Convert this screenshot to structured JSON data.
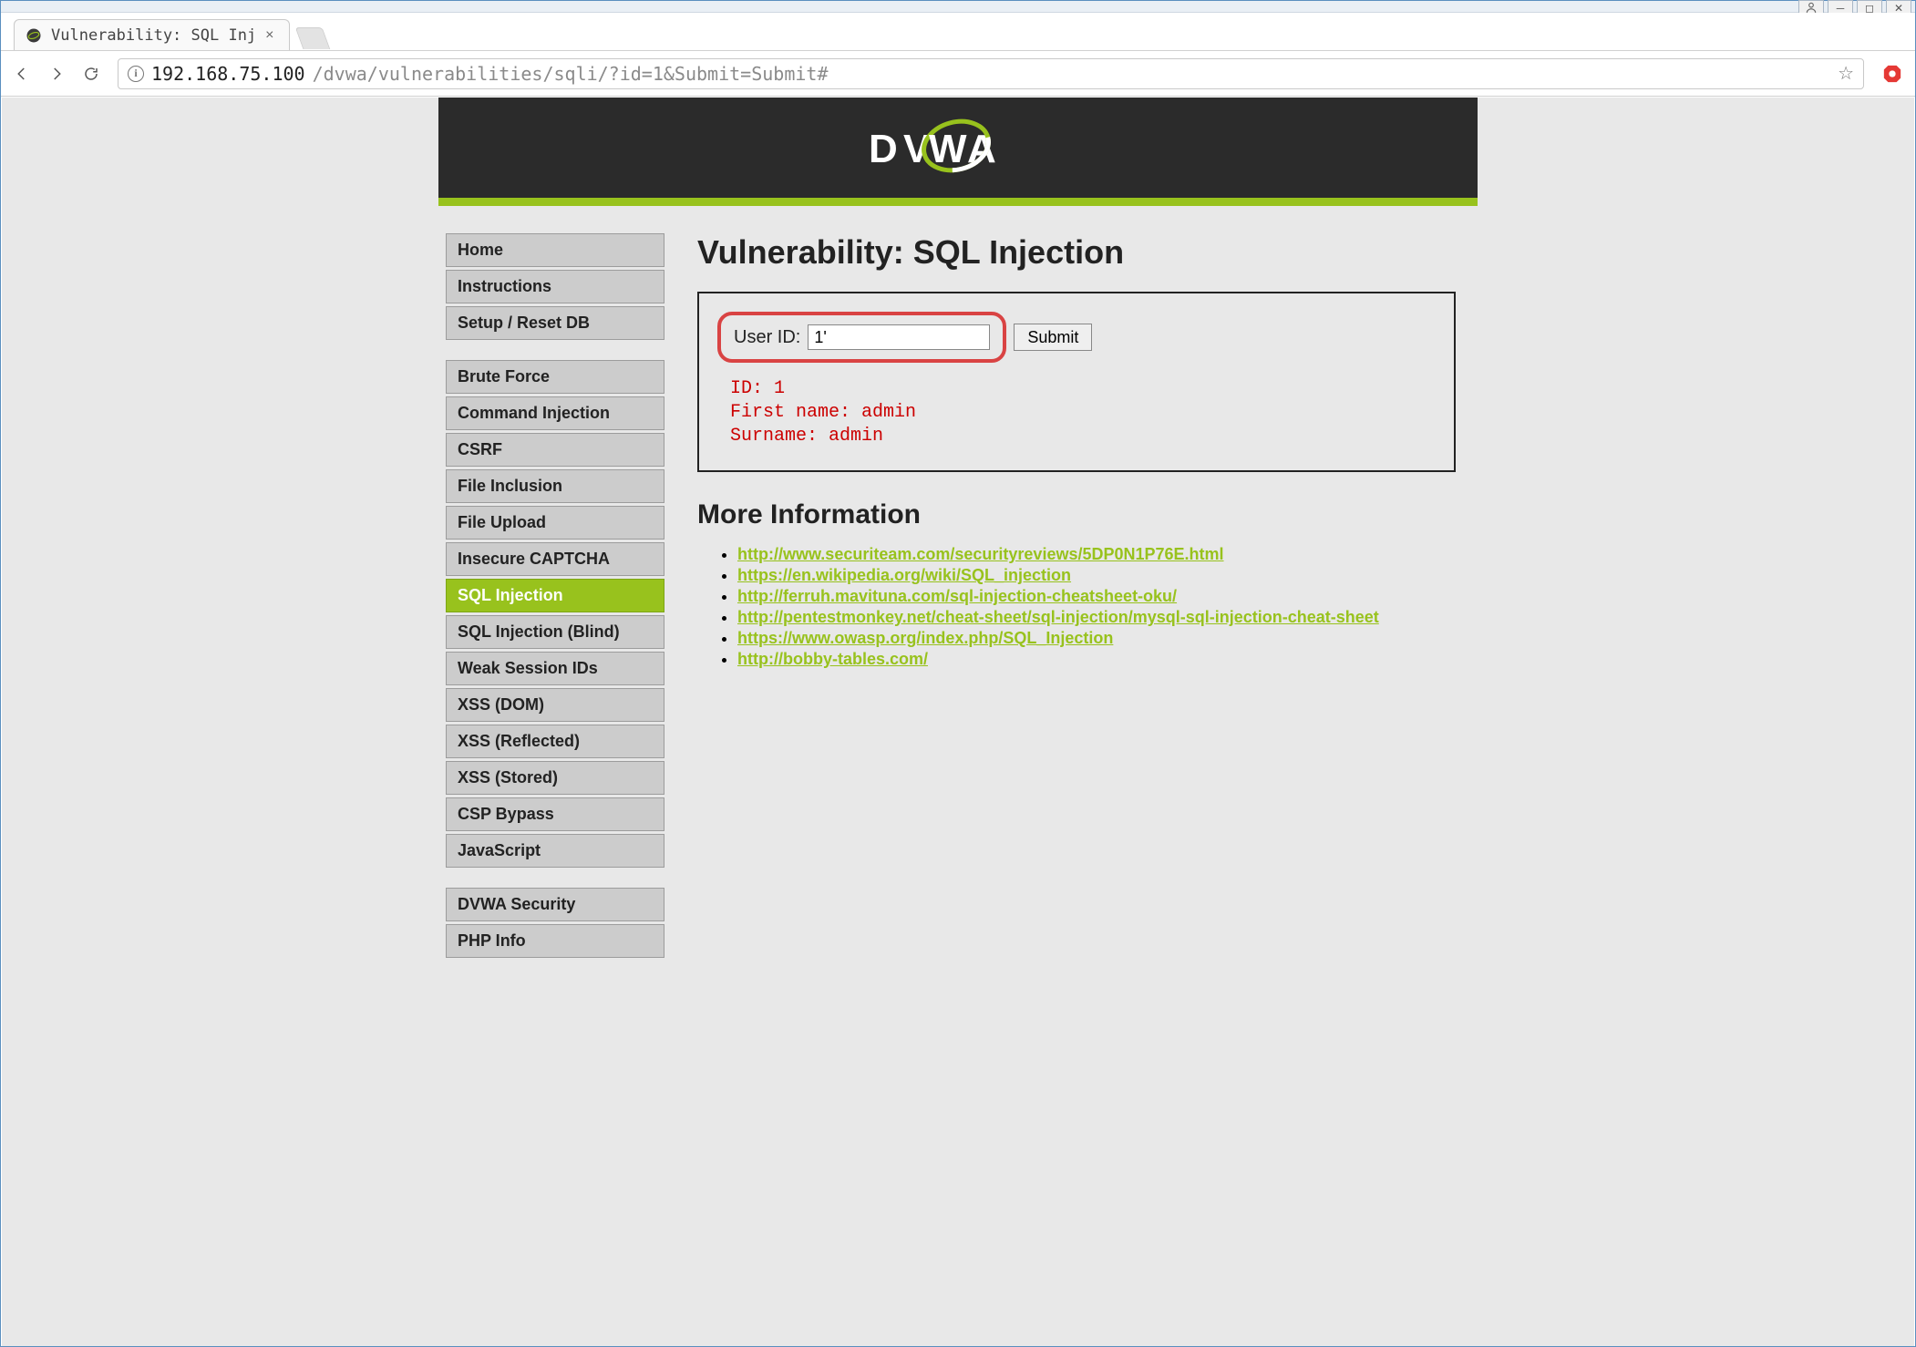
{
  "window": {
    "tab_title": "Vulnerability: SQL Inj",
    "url_host": "192.168.75.100",
    "url_path": "/dvwa/vulnerabilities/sqli/?id=1&Submit=Submit#"
  },
  "app": {
    "logo_text": "DVWA"
  },
  "sidebar": {
    "groups": [
      {
        "items": [
          {
            "label": "Home",
            "selected": false
          },
          {
            "label": "Instructions",
            "selected": false
          },
          {
            "label": "Setup / Reset DB",
            "selected": false
          }
        ]
      },
      {
        "items": [
          {
            "label": "Brute Force",
            "selected": false
          },
          {
            "label": "Command Injection",
            "selected": false
          },
          {
            "label": "CSRF",
            "selected": false
          },
          {
            "label": "File Inclusion",
            "selected": false
          },
          {
            "label": "File Upload",
            "selected": false
          },
          {
            "label": "Insecure CAPTCHA",
            "selected": false
          },
          {
            "label": "SQL Injection",
            "selected": true
          },
          {
            "label": "SQL Injection (Blind)",
            "selected": false
          },
          {
            "label": "Weak Session IDs",
            "selected": false
          },
          {
            "label": "XSS (DOM)",
            "selected": false
          },
          {
            "label": "XSS (Reflected)",
            "selected": false
          },
          {
            "label": "XSS (Stored)",
            "selected": false
          },
          {
            "label": "CSP Bypass",
            "selected": false
          },
          {
            "label": "JavaScript",
            "selected": false
          }
        ]
      },
      {
        "items": [
          {
            "label": "DVWA Security",
            "selected": false
          },
          {
            "label": "PHP Info",
            "selected": false
          }
        ]
      }
    ]
  },
  "main": {
    "title": "Vulnerability: SQL Injection",
    "form": {
      "label": "User ID:",
      "value": "1'",
      "submit_label": "Submit"
    },
    "result": "ID: 1\nFirst name: admin\nSurname: admin",
    "more_info_title": "More Information",
    "links": [
      "http://www.securiteam.com/securityreviews/5DP0N1P76E.html",
      "https://en.wikipedia.org/wiki/SQL_injection",
      "http://ferruh.mavituna.com/sql-injection-cheatsheet-oku/",
      "http://pentestmonkey.net/cheat-sheet/sql-injection/mysql-sql-injection-cheat-sheet",
      "https://www.owasp.org/index.php/SQL_Injection",
      "http://bobby-tables.com/"
    ]
  }
}
